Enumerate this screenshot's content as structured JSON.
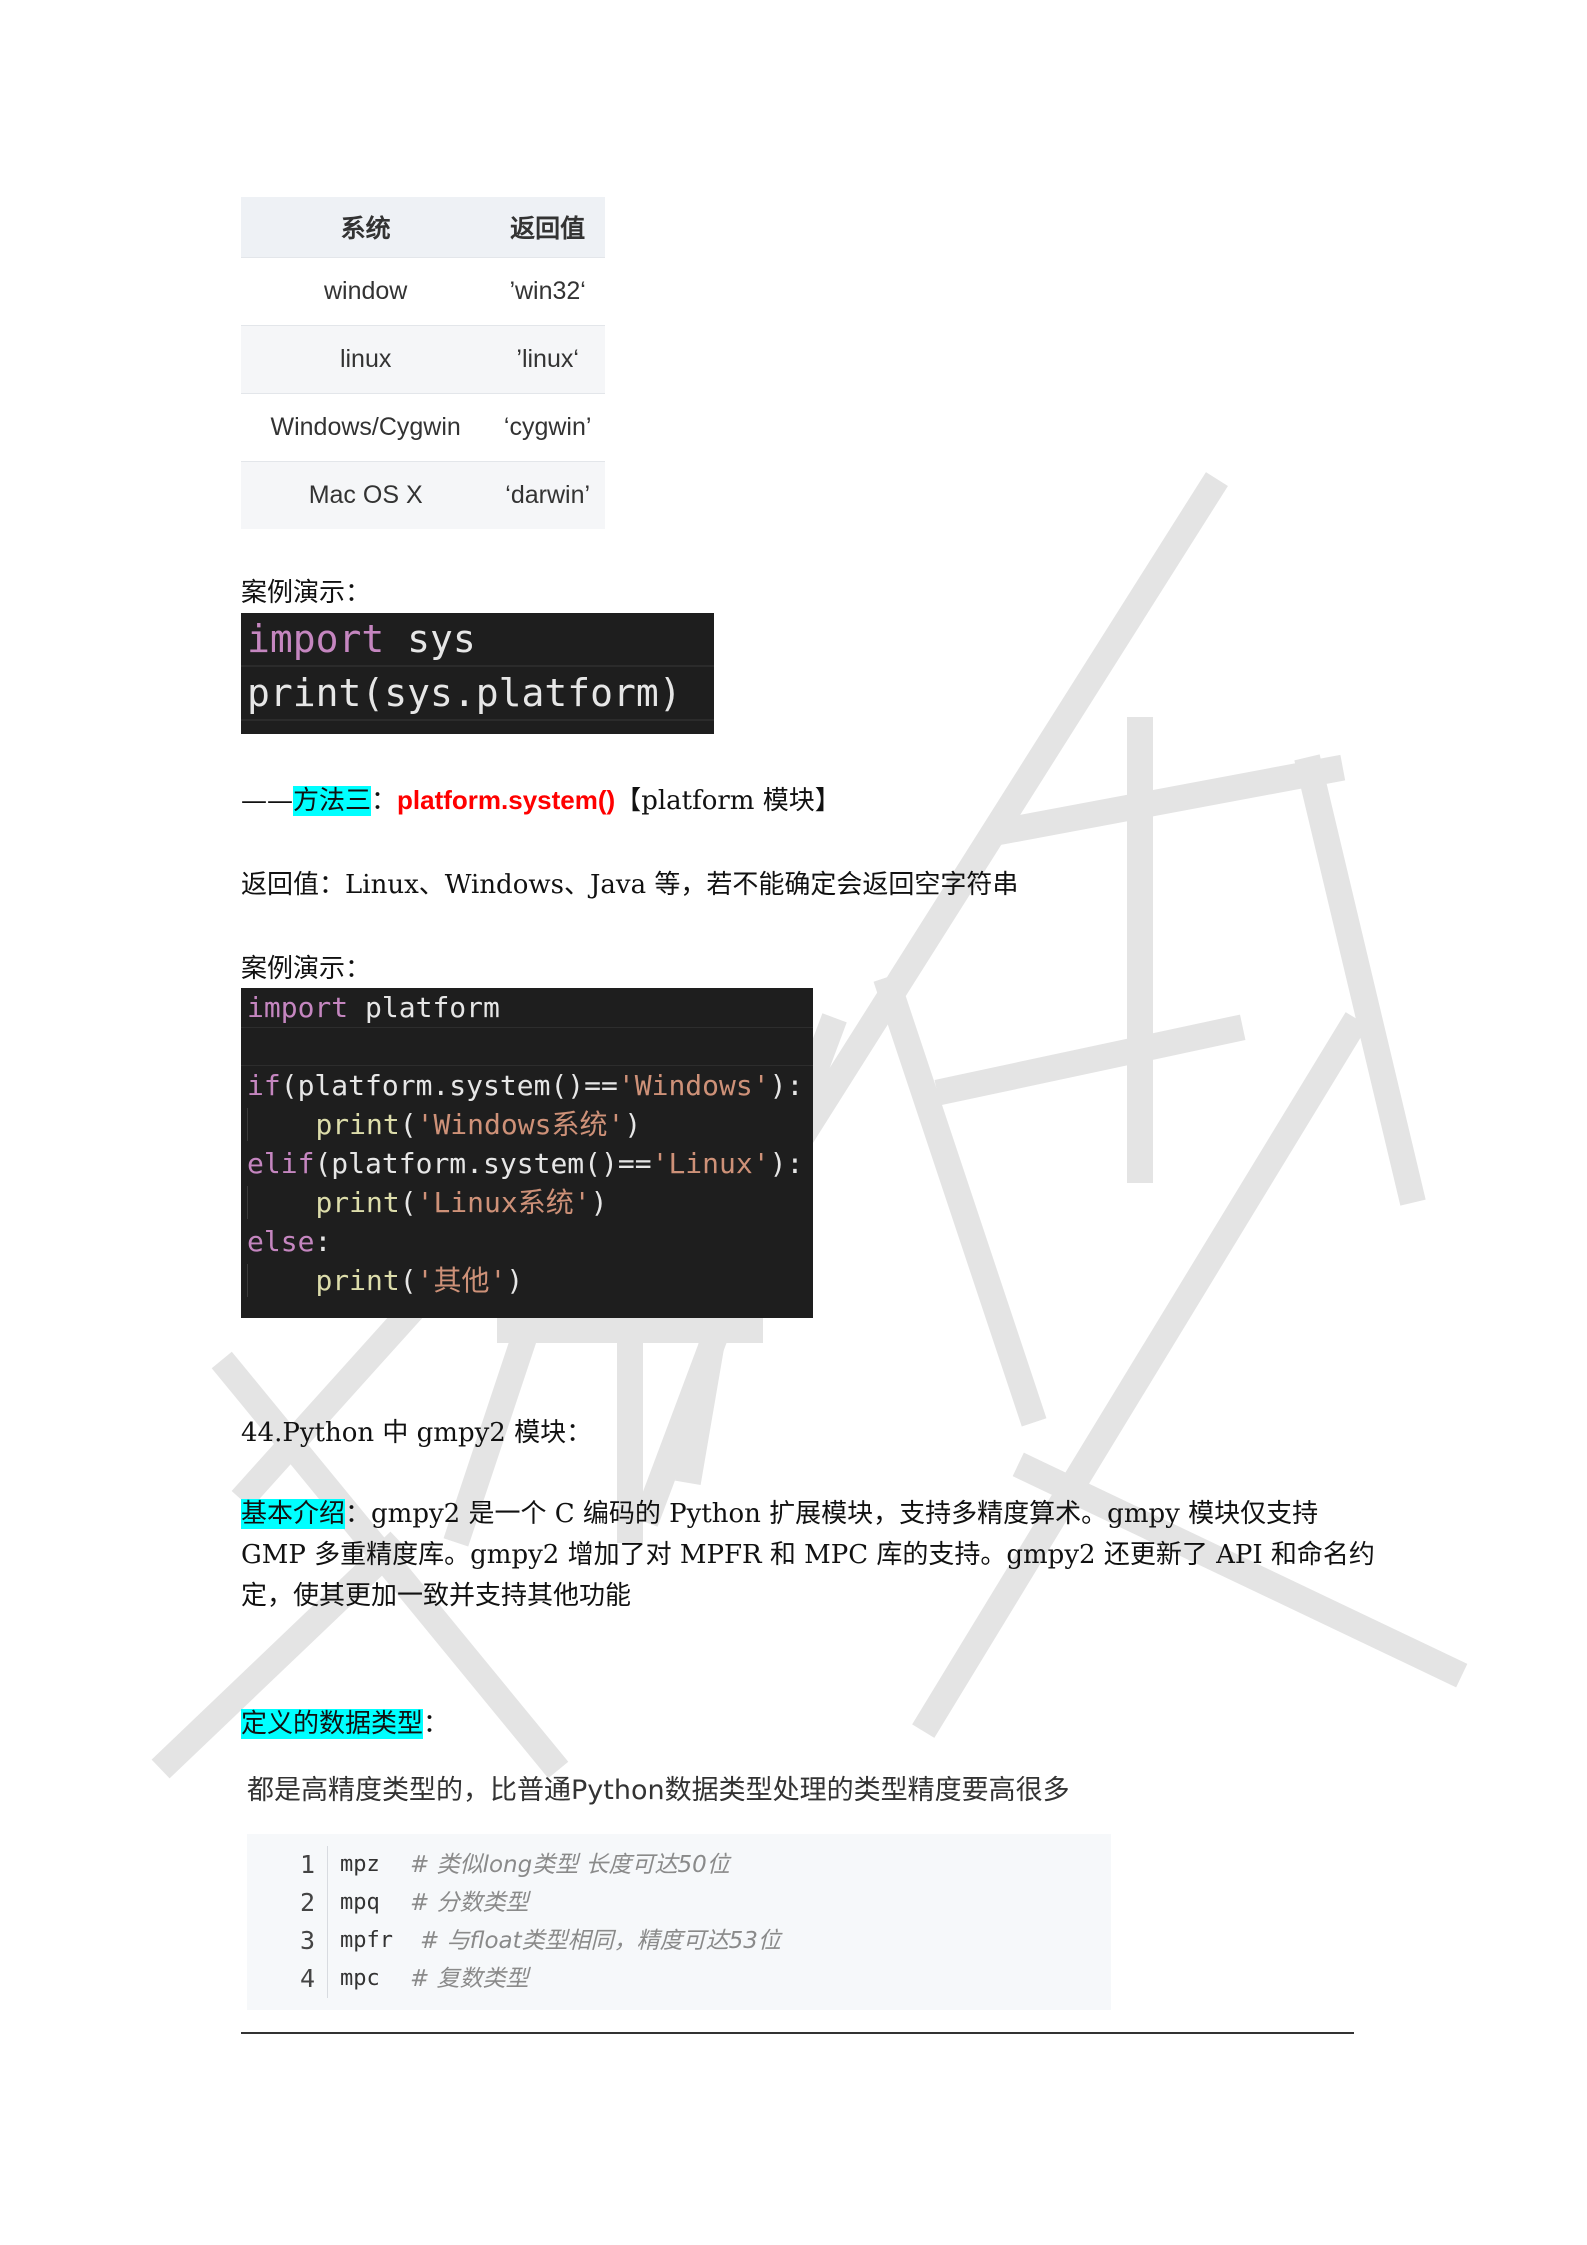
{
  "table": {
    "headers": [
      "系统",
      "返回值"
    ],
    "rows": [
      [
        "window",
        "’win32‘"
      ],
      [
        "linux",
        "’linux‘"
      ],
      [
        "Windows/Cygwin",
        "‘cygwin’"
      ],
      [
        "Mac OS X",
        "‘darwin’"
      ]
    ]
  },
  "demo1": {
    "label": "案例演示：",
    "code": [
      "import",
      " sys",
      "print(sys.platform)"
    ]
  },
  "method3": {
    "prefix": "——",
    "title": "方法三",
    "colon": "：",
    "func": "platform.system()",
    "module": "【platform 模块】"
  },
  "return_text": "返回值：Linux、Windows、Java 等，若不能确定会返回空字符串",
  "demo2": {
    "label": "案例演示：",
    "lines": {
      "l1_kw": "import",
      "l1_rest": " platform",
      "l3_kw": "if",
      "l3_a": "(platform.system()==",
      "l3_str": "'Windows'",
      "l3_b": "):",
      "l4_fn": "print",
      "l4_a": "(",
      "l4_str": "'Windows系统'",
      "l4_b": ")",
      "l5_kw": "elif",
      "l5_a": "(platform.system()==",
      "l5_str": "'Linux'",
      "l5_b": "):",
      "l6_fn": "print",
      "l6_a": "(",
      "l6_str": "'Linux系统'",
      "l6_b": ")",
      "l7_kw": "else",
      "l7_a": ":",
      "l8_fn": "print",
      "l8_a": "(",
      "l8_str": "'其他'",
      "l8_b": ")"
    }
  },
  "section44": "44.Python 中 gmpy2 模块：",
  "intro": {
    "label": "基本介绍",
    "line1": "：gmpy2 是一个 C 编码的 Python 扩展模块，支持多精度算术。gmpy 模块仅支持",
    "line2": "GMP 多重精度库。gmpy2 增加了对 MPFR 和 MPC 库的支持。gmpy2 还更新了 API 和命名约",
    "line3": "定，使其更加一致并支持其他功能"
  },
  "types": {
    "label": "定义的数据类型",
    "colon": "：",
    "desc": "都是高精度类型的，比普通Python数据类型处理的类型精度要高很多",
    "code": [
      {
        "num": "1",
        "type": "mpz",
        "comment": "# 类似long类型 长度可达50位"
      },
      {
        "num": "2",
        "type": "mpq",
        "comment": "# 分数类型"
      },
      {
        "num": "3",
        "type": "mpfr",
        "comment": "# 与float类型相同，精度可达53位"
      },
      {
        "num": "4",
        "type": "mpc",
        "comment": "# 复数类型"
      }
    ]
  }
}
